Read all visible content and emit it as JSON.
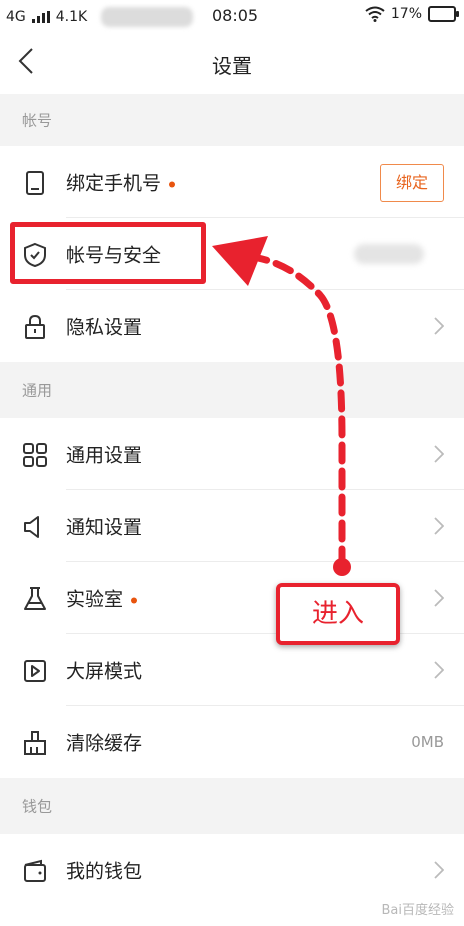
{
  "status_bar": {
    "network": "4G",
    "speed": "4.1K",
    "time": "08:05",
    "battery": "17%"
  },
  "header": {
    "title": "设置"
  },
  "sections": {
    "account": "帐号",
    "general": "通用",
    "wallet": "钱包"
  },
  "rows": {
    "bind_phone": {
      "label": "绑定手机号",
      "button": "绑定",
      "icon": "phone-icon"
    },
    "account_security": {
      "label": "帐号与安全",
      "icon": "shield-icon"
    },
    "privacy": {
      "label": "隐私设置",
      "icon": "lock-icon"
    },
    "general_settings": {
      "label": "通用设置",
      "icon": "grid-icon"
    },
    "notification": {
      "label": "通知设置",
      "icon": "speaker-icon"
    },
    "lab": {
      "label": "实验室",
      "icon": "flask-icon"
    },
    "big_screen": {
      "label": "大屏模式",
      "icon": "play-screen-icon"
    },
    "clear_cache": {
      "label": "清除缓存",
      "value": "0MB",
      "icon": "broom-icon"
    },
    "my_wallet": {
      "label": "我的钱包",
      "icon": "wallet-icon"
    }
  },
  "annotation": {
    "text": "进入"
  },
  "watermark": "Bai百度经验"
}
